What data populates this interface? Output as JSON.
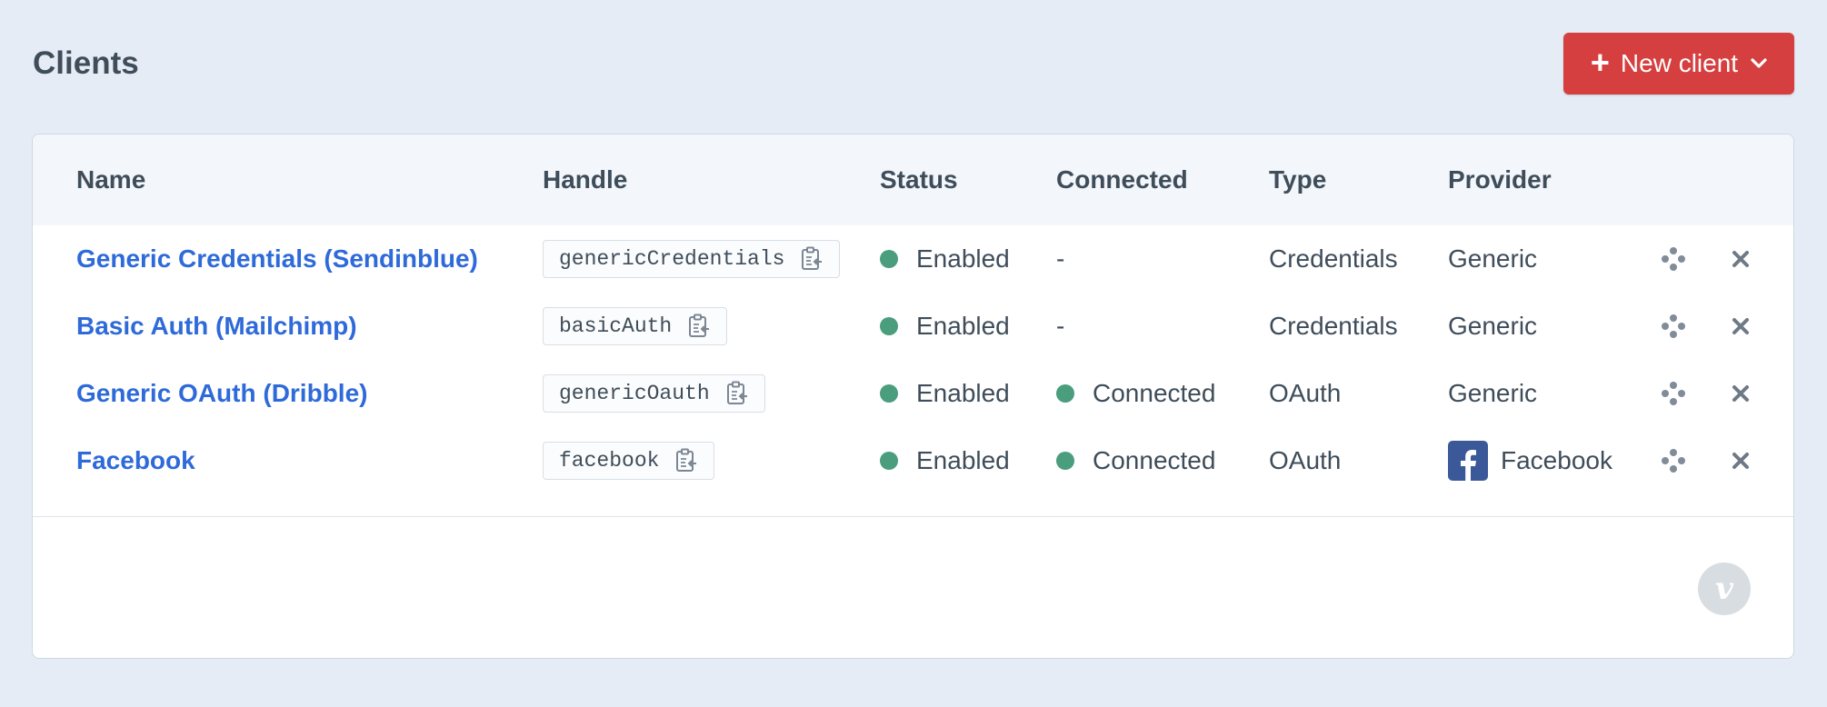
{
  "page": {
    "title": "Clients"
  },
  "toolbar": {
    "new_client_label": "New client"
  },
  "table": {
    "columns": {
      "name": "Name",
      "handle": "Handle",
      "status": "Status",
      "connected": "Connected",
      "type": "Type",
      "provider": "Provider"
    },
    "rows": [
      {
        "name": "Generic Credentials (Sendinblue)",
        "handle": "genericCredentials",
        "status": "Enabled",
        "connected": "-",
        "type": "Credentials",
        "provider": "Generic"
      },
      {
        "name": "Basic Auth (Mailchimp)",
        "handle": "basicAuth",
        "status": "Enabled",
        "connected": "-",
        "type": "Credentials",
        "provider": "Generic"
      },
      {
        "name": "Generic OAuth (Dribble)",
        "handle": "genericOauth",
        "status": "Enabled",
        "connected": "Connected",
        "type": "OAuth",
        "provider": "Generic"
      },
      {
        "name": "Facebook",
        "handle": "facebook",
        "status": "Enabled",
        "connected": "Connected",
        "type": "OAuth",
        "provider": "Facebook"
      }
    ]
  },
  "footer": {
    "badge_letter": "v"
  },
  "colors": {
    "accent": "#d63f3f",
    "link": "#2e6ad9",
    "status_green": "#4a9d7d",
    "facebook_blue": "#3b5998"
  }
}
